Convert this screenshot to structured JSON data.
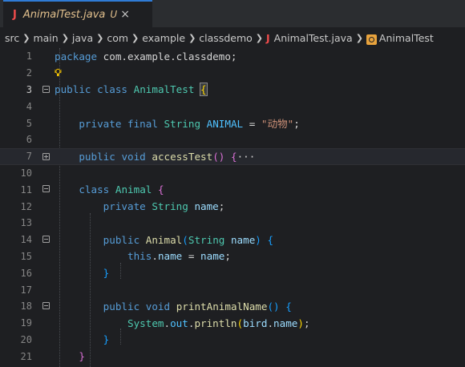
{
  "tab": {
    "icon": "J",
    "title": "AnimalTest.java",
    "badge": "U",
    "close": "×"
  },
  "breadcrumbs": [
    "src",
    "main",
    "java",
    "com",
    "example",
    "classdemo"
  ],
  "breadcrumb_file": {
    "icon": "J",
    "label": "AnimalTest.java"
  },
  "breadcrumb_symbol": {
    "icon": "class-icon",
    "label": "AnimalTest"
  },
  "lines": [
    {
      "n": "1",
      "text": "package com.example.classdemo;"
    },
    {
      "n": "2",
      "text": ""
    },
    {
      "n": "3",
      "text": "public class AnimalTest {"
    },
    {
      "n": "4",
      "text": ""
    },
    {
      "n": "5",
      "text": "private final String ANIMAL = \"动物\";"
    },
    {
      "n": "6",
      "text": ""
    },
    {
      "n": "7",
      "text": "public void accessTest() {···"
    },
    {
      "n": "10",
      "text": ""
    },
    {
      "n": "11",
      "text": "class Animal {"
    },
    {
      "n": "12",
      "text": "private String name;"
    },
    {
      "n": "13",
      "text": ""
    },
    {
      "n": "14",
      "text": "public Animal(String name) {"
    },
    {
      "n": "15",
      "text": "this.name = name;"
    },
    {
      "n": "16",
      "text": "}"
    },
    {
      "n": "17",
      "text": ""
    },
    {
      "n": "18",
      "text": "public void printAnimalName() {"
    },
    {
      "n": "19",
      "text": "System.out.println(bird.name);"
    },
    {
      "n": "20",
      "text": "}"
    },
    {
      "n": "21",
      "text": "}"
    }
  ],
  "tokens": {
    "package": "package",
    "pkg": "com.example.classdemo",
    "semi": ";",
    "public": "public",
    "class": "class",
    "AnimalTest": "AnimalTest",
    "lbrace": "{",
    "rbrace": "}",
    "private": "private",
    "final": "final",
    "String": "String",
    "ANIMAL": "ANIMAL",
    "eq": " = ",
    "animalStr": "\"动物\"",
    "void": "void",
    "accessTest": "accessTest",
    "parens": "()",
    "ellipsis": "···",
    "Animal": "Animal",
    "name": "name",
    "lparen": "(",
    "rparen": ")",
    "this": "this",
    "dot": ".",
    "printAnimalName": "printAnimalName",
    "System": "System",
    "out": "out",
    "println": "println",
    "bird": "bird"
  },
  "colors": {
    "keyword": "#569cd6",
    "type": "#4ec9b0",
    "function": "#dcdcaa",
    "string": "#ce9178",
    "constant": "#4fc1ff",
    "variable": "#9cdcfe",
    "tab_accent": "#2f7bd6",
    "java_icon": "#f14c4c"
  }
}
